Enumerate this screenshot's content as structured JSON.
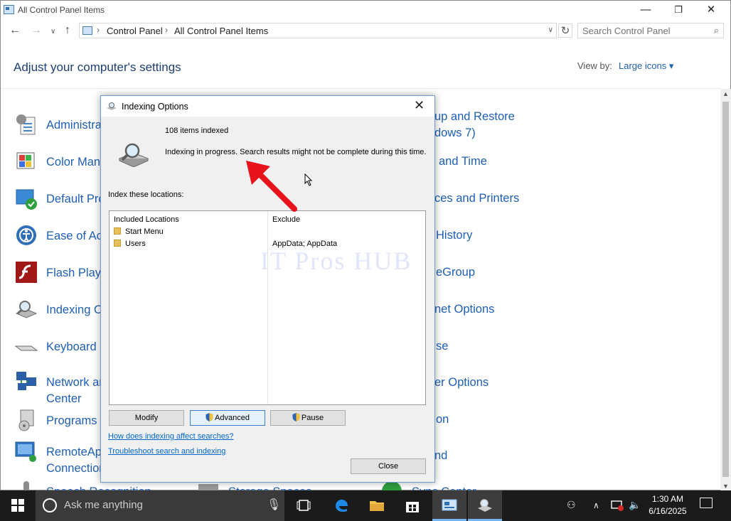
{
  "window": {
    "title": "All Control Panel Items",
    "controls": {
      "minimize": "—",
      "maximize": "❐",
      "close": "✕"
    }
  },
  "navigation": {
    "breadcrumb": [
      "Control Panel",
      "All Control Panel Items"
    ],
    "search_placeholder": "Search Control Panel"
  },
  "header": {
    "heading": "Adjust your computer's settings",
    "view_by_label": "View by:",
    "view_by_value": "Large icons ▾"
  },
  "items_left": [
    {
      "lines": [
        "Administra"
      ]
    },
    {
      "lines": [
        "Color Mana"
      ]
    },
    {
      "lines": [
        "Default Pro"
      ]
    },
    {
      "lines": [
        "Ease of Acc"
      ]
    },
    {
      "lines": [
        "Flash Playe"
      ]
    },
    {
      "lines": [
        "Indexing O"
      ]
    },
    {
      "lines": [
        "Keyboard"
      ]
    },
    {
      "lines": [
        "Network ar",
        "Center"
      ]
    },
    {
      "lines": [
        "Programs a"
      ]
    },
    {
      "lines": [
        "RemoteAp",
        "Connection"
      ]
    },
    {
      "lines": [
        "Speech Recognition"
      ]
    }
  ],
  "items_middle_partial": [
    {
      "label": "Storage Spaces"
    }
  ],
  "items_right_partial": [
    {
      "label": "up and Restore"
    },
    {
      "label": "dows 7)"
    },
    {
      "label": "and Time"
    },
    {
      "label": "ces and Printers"
    },
    {
      "label": "History"
    },
    {
      "label": "eGroup"
    },
    {
      "label": "net Options"
    },
    {
      "label": "se"
    },
    {
      "label": "er Options"
    },
    {
      "label": "on"
    },
    {
      "label": "nd"
    },
    {
      "label": "Sync Center"
    }
  ],
  "dialog": {
    "title": "Indexing Options",
    "items_indexed": "108 items indexed",
    "status_message": "Indexing in progress. Search results might not be complete during this time.",
    "locations_label": "Index these locations:",
    "table": {
      "col_included": "Included Locations",
      "col_exclude": "Exclude",
      "rows": [
        {
          "location": "Start Menu",
          "exclude": ""
        },
        {
          "location": "Users",
          "exclude": "AppData; AppData"
        }
      ]
    },
    "buttons": {
      "modify": "Modify",
      "advanced": "Advanced",
      "pause": "Pause",
      "close": "Close"
    },
    "links": {
      "how": "How does indexing affect searches?",
      "troubleshoot": "Troubleshoot search and indexing"
    }
  },
  "watermark": "IT Pros HUB",
  "taskbar": {
    "search_placeholder": "Ask me anything",
    "time": "1:30 AM",
    "date": "6/16/2025"
  },
  "colors": {
    "link_blue": "#1e5fb4",
    "heading_blue": "#1e3f6f",
    "dialog_bg": "#f0f0f0",
    "taskbar_bg": "#1b1b1b",
    "arrow_red": "#e8121b"
  }
}
